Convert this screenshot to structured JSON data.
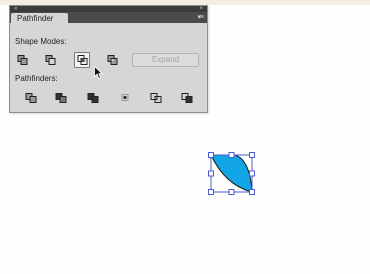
{
  "panel": {
    "title": "Pathfinder",
    "collapse_icon": "«",
    "close_icon": "×",
    "menu_icon": "▾≡",
    "shape_modes_label": "Shape Modes:",
    "pathfinders_label": "Pathfinders:",
    "expand_label": "Expand",
    "shape_mode_buttons": [
      "unite",
      "minus-front",
      "intersect",
      "exclude"
    ],
    "pathfinder_buttons": [
      "divide",
      "trim",
      "merge",
      "crop",
      "outline",
      "minus-back"
    ]
  },
  "colors": {
    "shape_fill": "#12a6e8",
    "selection": "#4b5bd6",
    "shape_stroke": "#1a1a1a"
  }
}
